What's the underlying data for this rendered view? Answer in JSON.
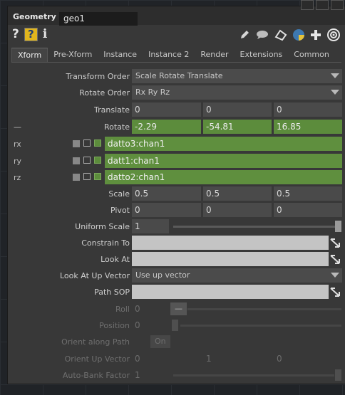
{
  "panel": {
    "type_label": "Geometry",
    "name": "geo1"
  },
  "icons": {
    "left": [
      "help-icon",
      "python-help-icon",
      "info-icon"
    ],
    "right": [
      "edit-icon",
      "comment-icon",
      "clone-icon",
      "python-icon",
      "add-icon",
      "target-icon"
    ]
  },
  "tabs": [
    "Xform",
    "Pre-Xform",
    "Instance",
    "Instance 2",
    "Render",
    "Extensions",
    "Common"
  ],
  "params": {
    "transform_order": {
      "label": "Transform Order",
      "value": "Scale Rotate Translate"
    },
    "rotate_order": {
      "label": "Rotate Order",
      "value": "Rx Ry Rz"
    },
    "translate": {
      "label": "Translate",
      "values": [
        "0",
        "0",
        "0"
      ]
    },
    "rotate": {
      "label": "Rotate",
      "values": [
        "-2.29",
        "-54.81",
        "16.85"
      ],
      "collapse": "—"
    },
    "rx": {
      "label": "rx",
      "expr": "datto3:chan1"
    },
    "ry": {
      "label": "ry",
      "expr": "datt1:chan1"
    },
    "rz": {
      "label": "rz",
      "expr": "datto2:chan1"
    },
    "scale": {
      "label": "Scale",
      "values": [
        "0.5",
        "0.5",
        "0.5"
      ]
    },
    "pivot": {
      "label": "Pivot",
      "values": [
        "0",
        "0",
        "0"
      ]
    },
    "uniform_scale": {
      "label": "Uniform Scale",
      "value": "1"
    },
    "constrain_to": {
      "label": "Constrain To",
      "value": ""
    },
    "look_at": {
      "label": "Look At",
      "value": ""
    },
    "look_at_up": {
      "label": "Look At Up Vector",
      "value": "Use up vector"
    },
    "path_sop": {
      "label": "Path SOP",
      "value": ""
    },
    "roll": {
      "label": "Roll",
      "value": "0",
      "button": "—"
    },
    "position": {
      "label": "Position",
      "value": "0"
    },
    "orient_along_path": {
      "label": "Orient along Path",
      "value": "On"
    },
    "orient_up_vector": {
      "label": "Orient Up Vector",
      "values": [
        "0",
        "1",
        "0"
      ]
    },
    "auto_bank": {
      "label": "Auto-Bank Factor",
      "value": "1"
    }
  },
  "colors": {
    "green": "#5c8c3c",
    "panel": "#383838",
    "field": "#4a4a4a",
    "help_yellow": "#e0b51d"
  }
}
